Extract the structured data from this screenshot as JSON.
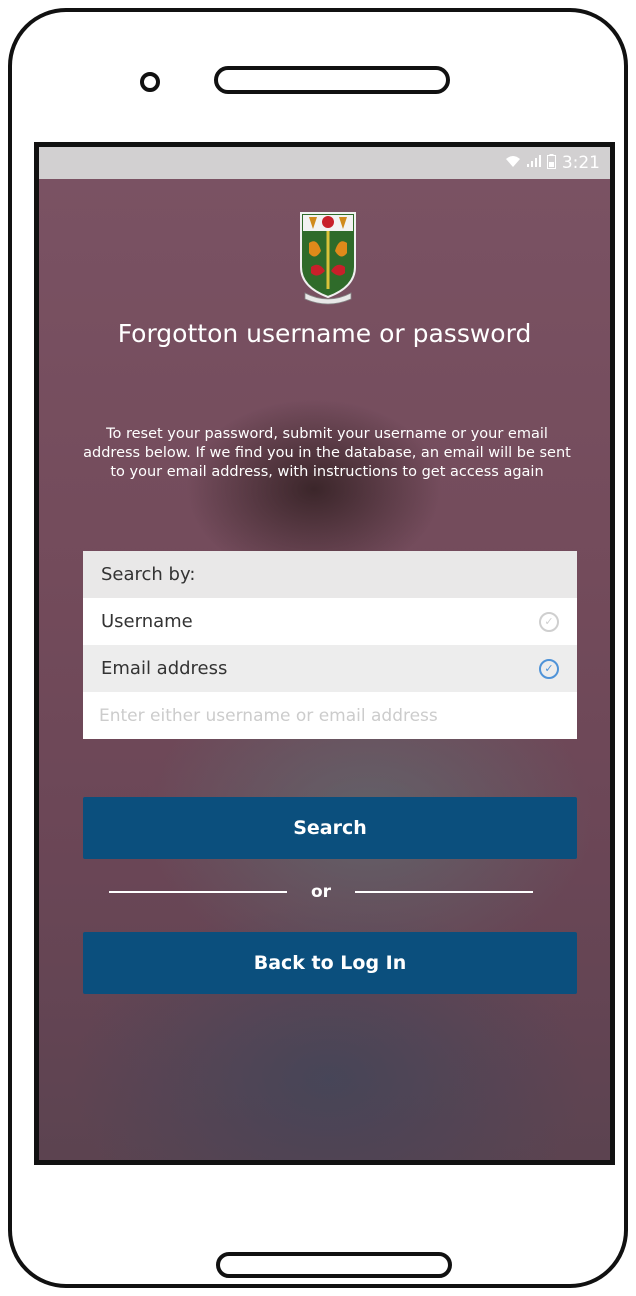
{
  "status_bar": {
    "time": "3:21"
  },
  "screen": {
    "title": "Forgotton username or password",
    "instructions": "To reset your password, submit your username or your email address below. If we find you in the database, an email will be sent to your email address, with instructions to get access again",
    "form": {
      "header": "Search by:",
      "options": [
        {
          "label": "Username",
          "selected": false
        },
        {
          "label": "Email address",
          "selected": true
        }
      ],
      "input_placeholder": "Enter either username or email address",
      "input_value": ""
    },
    "search_button": "Search",
    "divider_text": "or",
    "back_button": "Back to Log In"
  },
  "colors": {
    "button_bg": "#0b4f7d",
    "check_active": "#4f93d8",
    "screen_bg": "#6f4857"
  },
  "icons": [
    "wifi-icon",
    "signal-icon",
    "battery-icon",
    "check-circle-icon",
    "school-crest-logo"
  ]
}
